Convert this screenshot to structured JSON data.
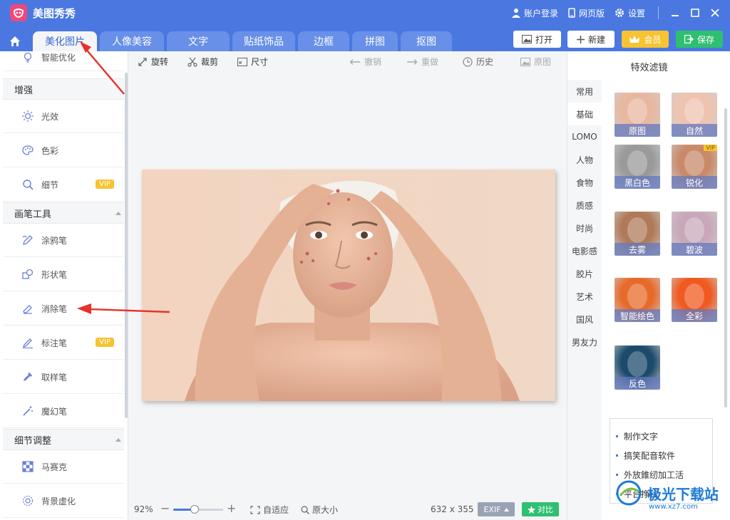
{
  "app": {
    "name": "美图秀秀",
    "colors": {
      "primary": "#4a78e0",
      "vip": "#f7c331",
      "save": "#2fbf71",
      "logo": "#f0487a"
    }
  },
  "titlebar": {
    "account": "账户登录",
    "web": "网页版",
    "settings": "设置"
  },
  "tabs": [
    {
      "label": "美化图片",
      "active": true
    },
    {
      "label": "人像美容"
    },
    {
      "label": "文字"
    },
    {
      "label": "贴纸饰品"
    },
    {
      "label": "边框"
    },
    {
      "label": "拼图"
    },
    {
      "label": "抠图"
    }
  ],
  "actions": {
    "open": "打开",
    "new": "新建",
    "vip": "会员",
    "save": "保存"
  },
  "sidebar": {
    "top_item": "智能优化",
    "sections": [
      {
        "title": "增强",
        "items": [
          {
            "label": "光效",
            "icon": "light-effect-icon"
          },
          {
            "label": "色彩",
            "icon": "palette-icon"
          },
          {
            "label": "细节",
            "icon": "detail-magnifier-icon",
            "vip": "VIP"
          }
        ]
      },
      {
        "title": "画笔工具",
        "items": [
          {
            "label": "涂鸦笔",
            "icon": "doodle-pen-icon"
          },
          {
            "label": "形状笔",
            "icon": "shape-pen-icon"
          },
          {
            "label": "消除笔",
            "icon": "eraser-pen-icon"
          },
          {
            "label": "标注笔",
            "icon": "annotation-pen-icon",
            "vip": "VIP"
          },
          {
            "label": "取样笔",
            "icon": "eyedropper-icon"
          },
          {
            "label": "魔幻笔",
            "icon": "magic-wand-icon"
          }
        ]
      },
      {
        "title": "细节调整",
        "items": [
          {
            "label": "马赛克",
            "icon": "mosaic-icon"
          },
          {
            "label": "背景虚化",
            "icon": "background-blur-icon"
          }
        ]
      }
    ]
  },
  "toolbar": {
    "rotate": "旋转",
    "crop": "裁剪",
    "size": "尺寸",
    "undo": "撤销",
    "redo": "重做",
    "history": "历史",
    "original": "原图"
  },
  "status": {
    "zoom": "92%",
    "zoom_fraction": 0.43,
    "fit": "自适应",
    "actual": "原大小",
    "dimensions": "632 x 355",
    "exif": "EXIF",
    "compare": "对比"
  },
  "filters": {
    "title": "特效滤镜",
    "categories": [
      "常用",
      "基础",
      "LOMO",
      "人物",
      "食物",
      "质感",
      "时尚",
      "电影感",
      "胶片",
      "艺术",
      "国风",
      "男友力"
    ],
    "active_category": "基础",
    "items": [
      {
        "label": "原图",
        "tint": "#e8b7a0"
      },
      {
        "label": "自然",
        "tint": "#eec3b0"
      },
      {
        "label": "黑白色",
        "tint": "#9a9a9a"
      },
      {
        "label": "锐化",
        "tint": "#c98a6a",
        "vip": "VIP"
      },
      {
        "label": "去雾",
        "tint": "#b07a5a"
      },
      {
        "label": "碧波",
        "tint": "#c8a8b8"
      },
      {
        "label": "智能绘色",
        "tint": "#e86a2a"
      },
      {
        "label": "全彩",
        "tint": "#f05a20"
      },
      {
        "label": "反色",
        "tint": "#1c4a6a"
      }
    ]
  },
  "ad": {
    "lines": [
      "制作文字",
      "搞笑配音软件",
      "外放錐纫加工活",
      "平台挣钱"
    ]
  },
  "watermark": {
    "text": "极光下载站",
    "sub": "www.xz7.com"
  }
}
